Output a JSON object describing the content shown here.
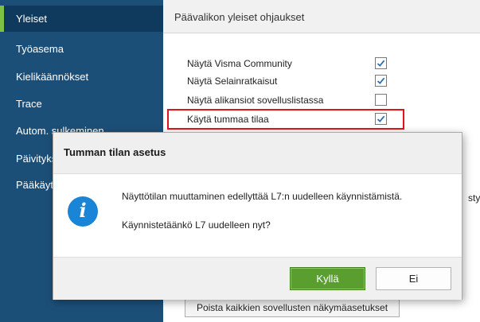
{
  "sidebar": {
    "items": [
      {
        "label": "Yleiset",
        "active": true
      },
      {
        "label": "Työasema",
        "active": false
      },
      {
        "label": "Kielikäännökset",
        "active": false
      },
      {
        "label": "Trace",
        "active": false
      },
      {
        "label": "Autom. sulkeminen",
        "active": false
      },
      {
        "label": "Päivitykset",
        "active": false
      },
      {
        "label": "Pääkäyttäjä",
        "active": false
      }
    ]
  },
  "main": {
    "title": "Päävalikon yleiset ohjaukset",
    "options": [
      {
        "label": "Näytä Visma Community",
        "checked": true
      },
      {
        "label": "Näytä Selainratkaisut",
        "checked": true
      },
      {
        "label": "Näytä alikansiot sovelluslistassa",
        "checked": false
      },
      {
        "label": "Käytä tummaa tilaa",
        "checked": true
      }
    ],
    "cut_text": "stys",
    "reset_button": "Poista kaikkien sovellusten näkymäasetukset"
  },
  "dialog": {
    "title": "Tumman tilan asetus",
    "icon": "info-icon",
    "message_line1": "Näyttötilan muuttaminen edellyttää L7:n uudelleen käynnistämistä.",
    "message_line2": "Käynnistetäänkö L7 uudelleen nyt?",
    "yes_label": "Kyllä",
    "no_label": "Ei"
  },
  "colors": {
    "sidebar": "#1c4f78",
    "sidebar_active": "#0f3a5e",
    "accent_green": "#7cc142",
    "primary_button": "#5a9e2f",
    "checkmark": "#2c6fb0",
    "highlight_red": "#e0141b",
    "info_blue": "#1a84d6"
  }
}
